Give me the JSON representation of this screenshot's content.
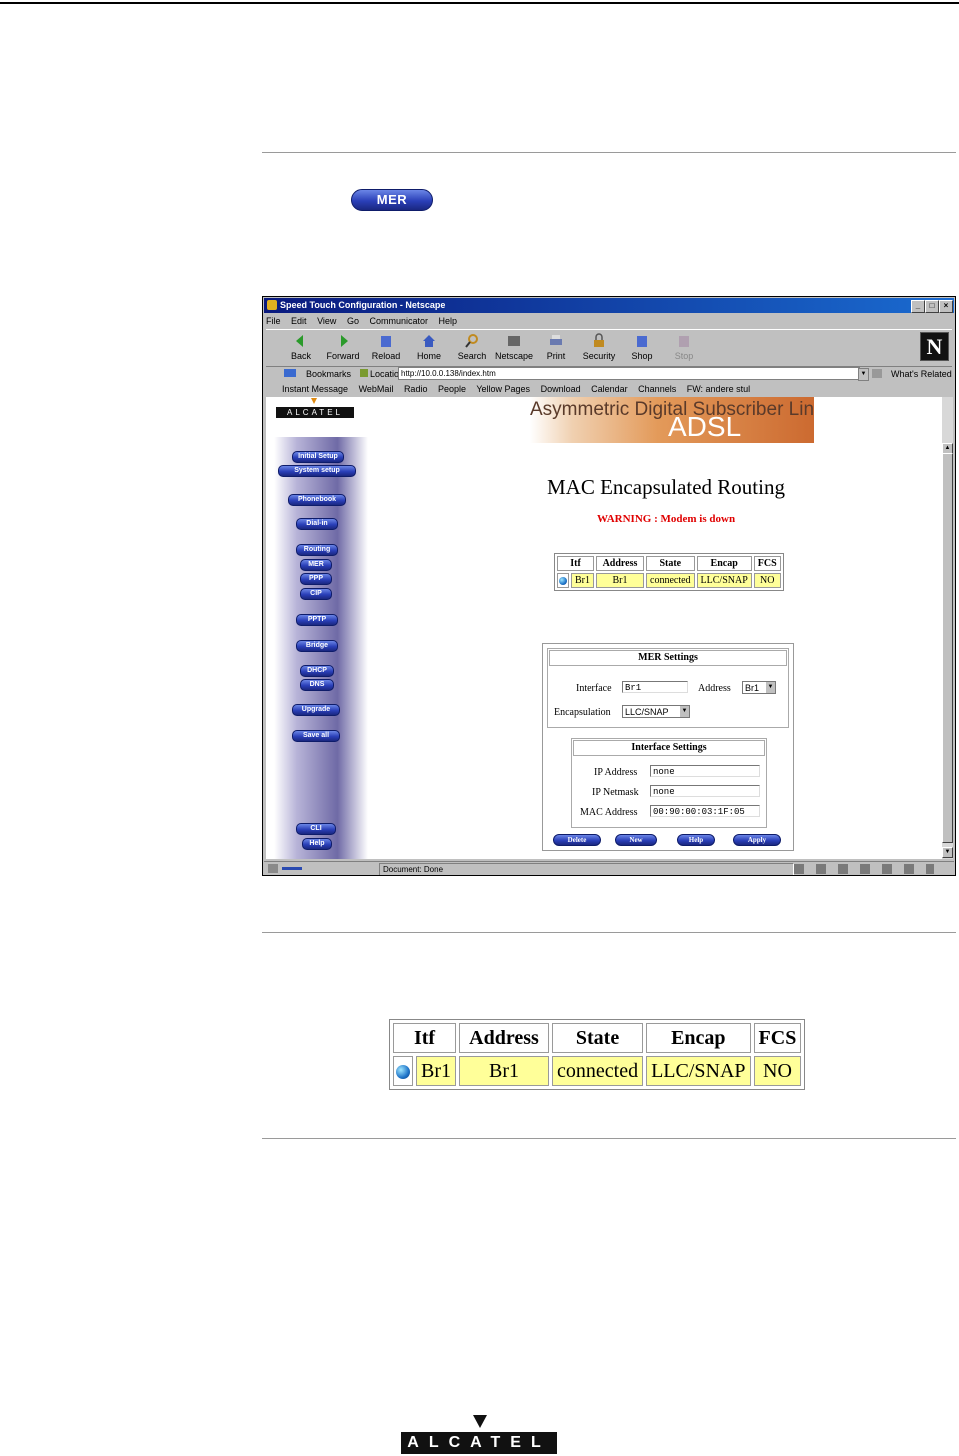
{
  "badge": "MER",
  "browser": {
    "title": "Speed Touch Configuration - Netscape",
    "menu": [
      "File",
      "Edit",
      "View",
      "Go",
      "Communicator",
      "Help"
    ],
    "toolbar": [
      "Back",
      "Forward",
      "Reload",
      "Home",
      "Search",
      "Netscape",
      "Print",
      "Security",
      "Shop",
      "Stop"
    ],
    "bookmarks_label": "Bookmarks",
    "location_label": "Location:",
    "location_value": "http://10.0.0.138/index.htm",
    "whats_related": "What's Related",
    "personal_bar": [
      "Instant Message",
      "WebMail",
      "Radio",
      "People",
      "Yellow Pages",
      "Download",
      "Calendar",
      "Channels",
      "FW: andere stul"
    ],
    "status": "Document: Done"
  },
  "page": {
    "logo": "ALCATEL",
    "banner_sub": "Asymmetric Digital Subscriber Line",
    "banner_big": "ADSL",
    "nav": [
      "Initial Setup",
      "System setup",
      "Phonebook",
      "Dial-in",
      "Routing",
      "MER",
      "PPP",
      "CIP",
      "PPTP",
      "Bridge",
      "DHCP",
      "DNS",
      "Upgrade",
      "Save all",
      "CLI",
      "Help"
    ],
    "title": "MAC Encapsulated Routing",
    "warning": "WARNING : Modem is down",
    "table": {
      "headers": [
        "Itf",
        "Address",
        "State",
        "Encap",
        "FCS"
      ],
      "row": [
        "Br1",
        "Br1",
        "connected",
        "LLC/SNAP",
        "NO"
      ]
    },
    "mer_settings": {
      "title": "MER Settings",
      "interface_label": "Interface",
      "interface_value": "Br1",
      "address_label": "Address",
      "address_value": "Br1",
      "encap_label": "Encapsulation",
      "encap_value": "LLC/SNAP"
    },
    "interface_settings": {
      "title": "Interface Settings",
      "ip_label": "IP Address",
      "ip_value": "none",
      "netmask_label": "IP Netmask",
      "netmask_value": "none",
      "mac_label": "MAC Address",
      "mac_value": "00:90:00:03:1F:05"
    },
    "buttons": [
      "Delete",
      "New",
      "Help",
      "Apply"
    ]
  },
  "footer_logo": "ALCATEL"
}
